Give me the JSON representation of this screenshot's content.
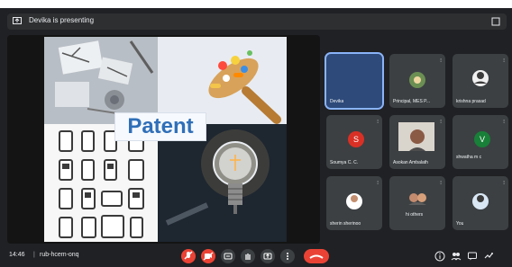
{
  "topbar": {
    "presenting": "Devika is presenting"
  },
  "slide": {
    "title": "Patent"
  },
  "participants": [
    {
      "name": "Devika",
      "role": "active"
    },
    {
      "name": "Principal, MES P..."
    },
    {
      "name": "krishna prasad"
    },
    {
      "name": "Soumya C. C.",
      "initial": "S"
    },
    {
      "name": "Asokan Ambalath"
    },
    {
      "name": "shwatha m c",
      "initial": "V"
    },
    {
      "name": "sherin sherinoo"
    },
    {
      "name": "hi others"
    },
    {
      "name": "You"
    }
  ],
  "bottom": {
    "time": "14:46",
    "separator": "|",
    "meeting_code": "rub-hcem-onq"
  },
  "colors": {
    "end_call": "#ea4335",
    "muted": "#ea4335",
    "accent": "#8ab4f8",
    "background": "#202124"
  }
}
